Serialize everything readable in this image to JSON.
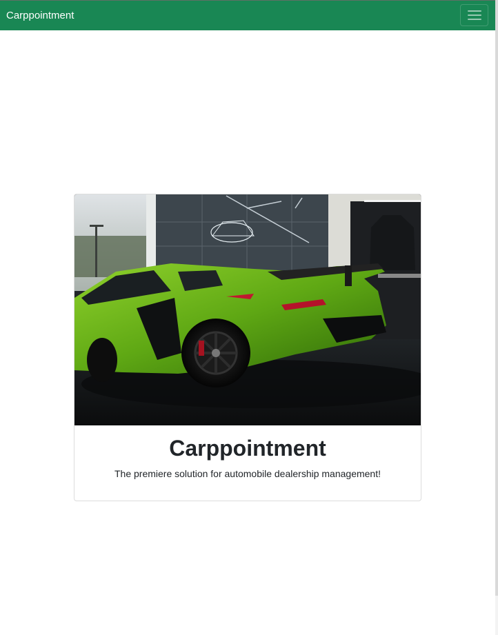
{
  "navbar": {
    "brand": "Carppointment",
    "toggler_icon": "hamburger-menu-icon",
    "background_color": "#198754"
  },
  "hero_card": {
    "image_subject": "green sports car in showroom",
    "title": "Carppointment",
    "tagline": "The premiere solution for automobile dealership management!"
  }
}
